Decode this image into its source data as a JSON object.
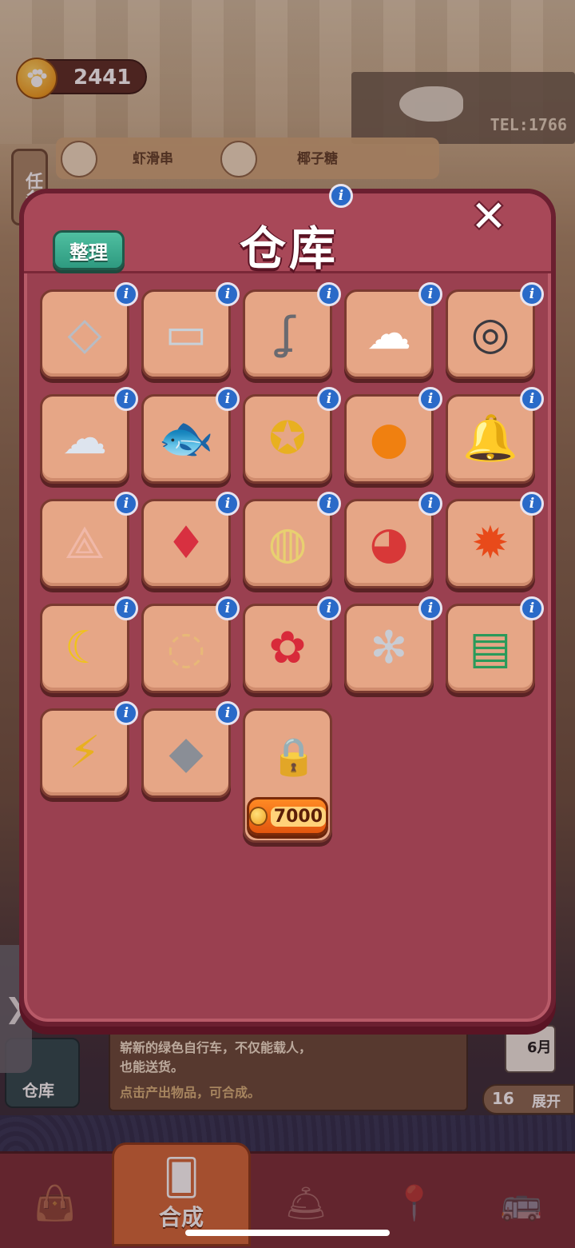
{
  "hud": {
    "paw_count": "2441",
    "task_tab_label": "任务"
  },
  "scene": {
    "sign_text": "TEL:1766",
    "orders": [
      {
        "label": "虾滑串",
        "icon": "shrimp-skewer-icon"
      },
      {
        "label": "椰子糖",
        "icon": "coconut-candy-icon"
      }
    ]
  },
  "warehouse_modal": {
    "title": "仓库",
    "info_symbol": "i",
    "sort_label": "整理",
    "close_symbol": "✕",
    "slots": [
      {
        "item": "metal-plate-icon",
        "glyph": "◇",
        "color": "#b8bcc4"
      },
      {
        "item": "glass-panes-icon",
        "glyph": "▭",
        "color": "#c8d0d8"
      },
      {
        "item": "metal-hook-icon",
        "glyph": "ʆ",
        "color": "#6a6a70"
      },
      {
        "item": "chef-hat-icon",
        "glyph": "☁",
        "color": "#ffffff"
      },
      {
        "item": "tire-icon",
        "glyph": "◎",
        "color": "#3a3a40"
      },
      {
        "item": "silver-scrap-icon",
        "glyph": "☁",
        "color": "#dde4ee"
      },
      {
        "item": "fish-plaque-icon",
        "glyph": "🐟",
        "color": "#4a5a7a"
      },
      {
        "item": "gold-medal-icon",
        "glyph": "✪",
        "color": "#e8b020"
      },
      {
        "item": "amber-stone-icon",
        "glyph": "●",
        "color": "#f08010"
      },
      {
        "item": "wind-chime-icon",
        "glyph": "🔔",
        "color": "#e8d8f8"
      },
      {
        "item": "paper-boat-icon",
        "glyph": "⟁",
        "color": "#f0b8a8"
      },
      {
        "item": "lucky-bag-icon",
        "glyph": "♦",
        "color": "#d83040"
      },
      {
        "item": "stew-pot-icon",
        "glyph": "◍",
        "color": "#e8d070"
      },
      {
        "item": "watermelon-slices-icon",
        "glyph": "◕",
        "color": "#d83838"
      },
      {
        "item": "maple-wreath-icon",
        "glyph": "✹",
        "color": "#e84a1a"
      },
      {
        "item": "crescent-moon-icon",
        "glyph": "☾",
        "color": "#f0c418"
      },
      {
        "item": "prayer-beads-icon",
        "glyph": "◌",
        "color": "#e8b878"
      },
      {
        "item": "firecracker-bouquet-icon",
        "glyph": "✿",
        "color": "#d82a3a"
      },
      {
        "item": "silver-gear-icon",
        "glyph": "✻",
        "color": "#c8ccd4"
      },
      {
        "item": "calendar-tickets-icon",
        "glyph": "▤",
        "color": "#2a9a5a"
      },
      {
        "item": "energy-battery-icon",
        "glyph": "⚡",
        "color": "#e8b020"
      },
      {
        "item": "stone-blocks-icon",
        "glyph": "◆",
        "color": "#8a8e96"
      }
    ],
    "locked_slot": {
      "unlock_price": "7000"
    }
  },
  "background_panel": {
    "warehouse_shortcut_label": "仓库",
    "description_line1": "崭新的绿色自行车，不仅能载人，",
    "description_line2": "也能送货。",
    "hint": "点击产出物品，可合成。",
    "calendar_month": "6月",
    "expand_count": "16",
    "expand_label": "展开",
    "side_arrow": "❯"
  },
  "bottom_nav": {
    "items": [
      {
        "name": "shop",
        "icon": "shopping-bag-icon",
        "glyph": "👜",
        "label": ""
      },
      {
        "name": "merge",
        "icon": "merge-cards-icon",
        "glyph": "🂠",
        "label": "合成"
      },
      {
        "name": "service",
        "icon": "service-bell-icon",
        "glyph": "🛎",
        "label": ""
      },
      {
        "name": "map",
        "icon": "map-pin-icon",
        "glyph": "📍",
        "label": ""
      },
      {
        "name": "travel",
        "icon": "bus-icon",
        "glyph": "🚌",
        "label": ""
      }
    ]
  },
  "colors": {
    "modal_bg": "#9a4050",
    "slot_bg": "#e6a686",
    "info_badge": "#2a6ac8",
    "sort_button": "#3aaa8c",
    "price_button": "#f07018"
  }
}
